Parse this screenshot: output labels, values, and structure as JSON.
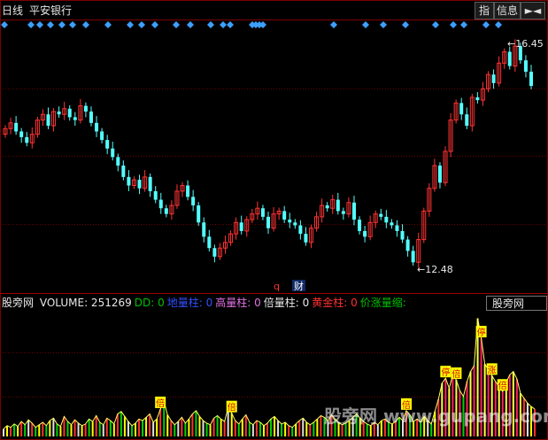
{
  "window": {
    "period": "日线",
    "stock_name": "平安银行",
    "btn_index": "指",
    "btn_info": "信息",
    "btn_arrow": "►◄"
  },
  "colors": {
    "up": "#ff3333",
    "down": "#54ffff",
    "marker": "#3da0ff",
    "grid": "#6a0000",
    "gold": "#ffff00"
  },
  "main_chart": {
    "high_label": "16.45",
    "low_label": "12.48",
    "mark_q": "q",
    "mark_cai": "财",
    "diamond_positions": [
      5,
      35,
      45,
      57,
      70,
      82,
      97,
      122,
      147,
      160,
      175,
      199,
      215,
      238,
      252,
      260,
      285,
      289,
      293,
      297,
      377,
      413,
      433,
      458,
      492,
      512,
      524,
      549,
      563
    ]
  },
  "chart_data": [
    {
      "type": "candlestick",
      "title": "",
      "ylim": [
        12.2,
        16.65
      ],
      "high": 16.45,
      "low": 12.48,
      "closes": [
        14.95,
        15.05,
        14.9,
        14.8,
        14.7,
        14.85,
        15.1,
        15.2,
        15.0,
        15.25,
        15.2,
        15.3,
        15.15,
        15.1,
        15.35,
        15.25,
        15.05,
        14.9,
        14.75,
        14.6,
        14.45,
        14.3,
        14.1,
        13.95,
        14.05,
        13.9,
        14.1,
        13.85,
        13.7,
        13.55,
        13.45,
        13.6,
        13.85,
        13.95,
        13.75,
        13.6,
        13.3,
        13.05,
        12.85,
        12.7,
        12.85,
        12.95,
        13.1,
        13.3,
        13.15,
        13.35,
        13.45,
        13.55,
        13.4,
        13.2,
        13.45,
        13.5,
        13.35,
        13.3,
        13.25,
        13.1,
        12.95,
        13.2,
        13.4,
        13.6,
        13.55,
        13.7,
        13.5,
        13.45,
        13.65,
        13.35,
        13.15,
        13.05,
        13.3,
        13.45,
        13.4,
        13.3,
        13.25,
        13.15,
        13.0,
        12.8,
        12.6,
        13.0,
        13.5,
        13.9,
        14.3,
        14.0,
        14.55,
        15.1,
        15.4,
        15.2,
        15.0,
        15.5,
        15.45,
        15.65,
        15.9,
        15.75,
        16.1,
        16.3,
        16.05,
        16.4,
        16.15,
        15.95,
        15.7
      ],
      "opens": [
        14.85,
        14.95,
        15.05,
        14.9,
        14.8,
        14.7,
        14.85,
        15.1,
        15.2,
        15.0,
        15.25,
        15.2,
        15.3,
        15.15,
        15.1,
        15.35,
        15.25,
        15.05,
        14.9,
        14.75,
        14.6,
        14.45,
        14.3,
        14.1,
        13.95,
        14.05,
        13.9,
        14.1,
        13.85,
        13.7,
        13.55,
        13.45,
        13.6,
        13.85,
        13.95,
        13.75,
        13.6,
        13.3,
        13.05,
        12.85,
        12.7,
        12.85,
        12.95,
        13.1,
        13.3,
        13.15,
        13.35,
        13.45,
        13.55,
        13.4,
        13.2,
        13.45,
        13.5,
        13.35,
        13.3,
        13.25,
        13.1,
        12.95,
        13.2,
        13.4,
        13.6,
        13.55,
        13.7,
        13.5,
        13.45,
        13.65,
        13.35,
        13.15,
        13.05,
        13.3,
        13.45,
        13.4,
        13.3,
        13.25,
        13.15,
        13.0,
        12.8,
        12.6,
        13.0,
        13.5,
        13.9,
        14.3,
        14.0,
        14.55,
        15.1,
        15.4,
        15.2,
        15.0,
        15.5,
        15.45,
        15.65,
        15.9,
        15.75,
        16.1,
        16.3,
        16.05,
        16.4,
        16.15,
        15.95
      ]
    },
    {
      "type": "bar",
      "title": "",
      "volume_value": "251269",
      "legend": [
        {
          "name": "股旁网 ",
          "color": "#e8e8e8"
        },
        {
          "name": "VOLUME: 251269",
          "color": "#e8e8e8"
        },
        {
          "name": "DD: 0",
          "color": "#00c000"
        },
        {
          "name": "地量柱: 0",
          "color": "#3050ff"
        },
        {
          "name": "高量柱: 0",
          "color": "#e070e0"
        },
        {
          "name": "倍量柱: 0",
          "color": "#e8e8e8"
        },
        {
          "name": "黄金柱: 0",
          "color": "#ff3030"
        },
        {
          "name": "价涨量缩:",
          "color": "#00c000"
        }
      ],
      "selector_label": "股旁网",
      "bar_labels": [
        {
          "text": "倍",
          "bar": 44
        },
        {
          "text": "倍",
          "bar": 64
        },
        {
          "text": "倍",
          "bar": 127
        },
        {
          "text": "涨",
          "bar": 137
        },
        {
          "text": "停",
          "bar": 124
        },
        {
          "text": "停",
          "bar": 134
        },
        {
          "text": "倍",
          "bar": 140
        },
        {
          "text": "倍",
          "bar": 113
        }
      ],
      "values": [
        9,
        13,
        11,
        15,
        12,
        18,
        14,
        20,
        16,
        11,
        14,
        17,
        13,
        19,
        22,
        15,
        12,
        24,
        18,
        14,
        20,
        16,
        13,
        15,
        21,
        18,
        25,
        17,
        14,
        22,
        19,
        15,
        27,
        30,
        24,
        18,
        13,
        16,
        21,
        19,
        23,
        27,
        17,
        21,
        33,
        42,
        26,
        19,
        14,
        18,
        23,
        16,
        21,
        27,
        31,
        24,
        19,
        16,
        14,
        22,
        25,
        21,
        18,
        35,
        28,
        19,
        15,
        21,
        26,
        17,
        14,
        19,
        17,
        13,
        16,
        21,
        24,
        19,
        15,
        17,
        13,
        11,
        15,
        19,
        22,
        17,
        14,
        17,
        21,
        25,
        23,
        19,
        26,
        21,
        17,
        14,
        16,
        19,
        23,
        27,
        22,
        18,
        15,
        13,
        17,
        14,
        19,
        21,
        17,
        15,
        18,
        23,
        19,
        31,
        26,
        18,
        21,
        17,
        24,
        19,
        15,
        30,
        45,
        64,
        70,
        58,
        74,
        68,
        55,
        48,
        66,
        78,
        85,
        142,
        118,
        87,
        80,
        73,
        66,
        60,
        54,
        65,
        74,
        78,
        69,
        52,
        46,
        40,
        36,
        33
      ]
    }
  ]
}
